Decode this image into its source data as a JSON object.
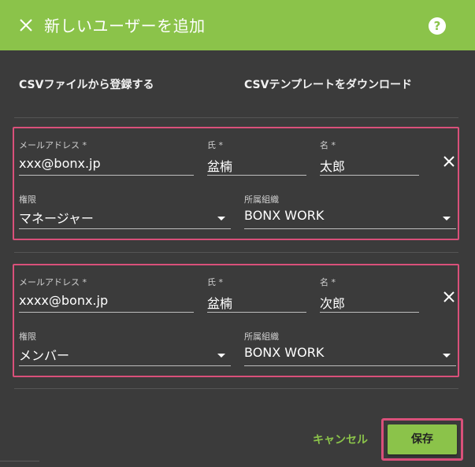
{
  "header": {
    "title": "新しいユーザーを追加",
    "help_label": "?",
    "bg_color": "#8bc34a"
  },
  "links": {
    "csv_upload": "CSVファイルから登録する",
    "csv_template": "CSVテンプレートをダウンロード"
  },
  "rows": [
    {
      "email_label": "メールアドレス *",
      "email_value": "xxx@bonx.jp",
      "last_label": "氏 *",
      "last_value": "盆楠",
      "first_label": "名 *",
      "first_value": "太郎",
      "role_label": "権限",
      "role_value": "マネージャー",
      "org_label": "所属組織",
      "org_value": "BONX WORK"
    },
    {
      "email_label": "メールアドレス *",
      "email_value": "xxxx@bonx.jp",
      "last_label": "氏 *",
      "last_value": "盆楠",
      "first_label": "名 *",
      "first_value": "次郎",
      "role_label": "権限",
      "role_value": "メンバー",
      "org_label": "所属組織",
      "org_value": "BONX WORK"
    }
  ],
  "footer": {
    "cancel_label": "キャンセル",
    "save_label": "保存"
  },
  "colors": {
    "accent": "#8bc34a",
    "highlight": "#d9507a",
    "background": "#3b3b3b"
  }
}
